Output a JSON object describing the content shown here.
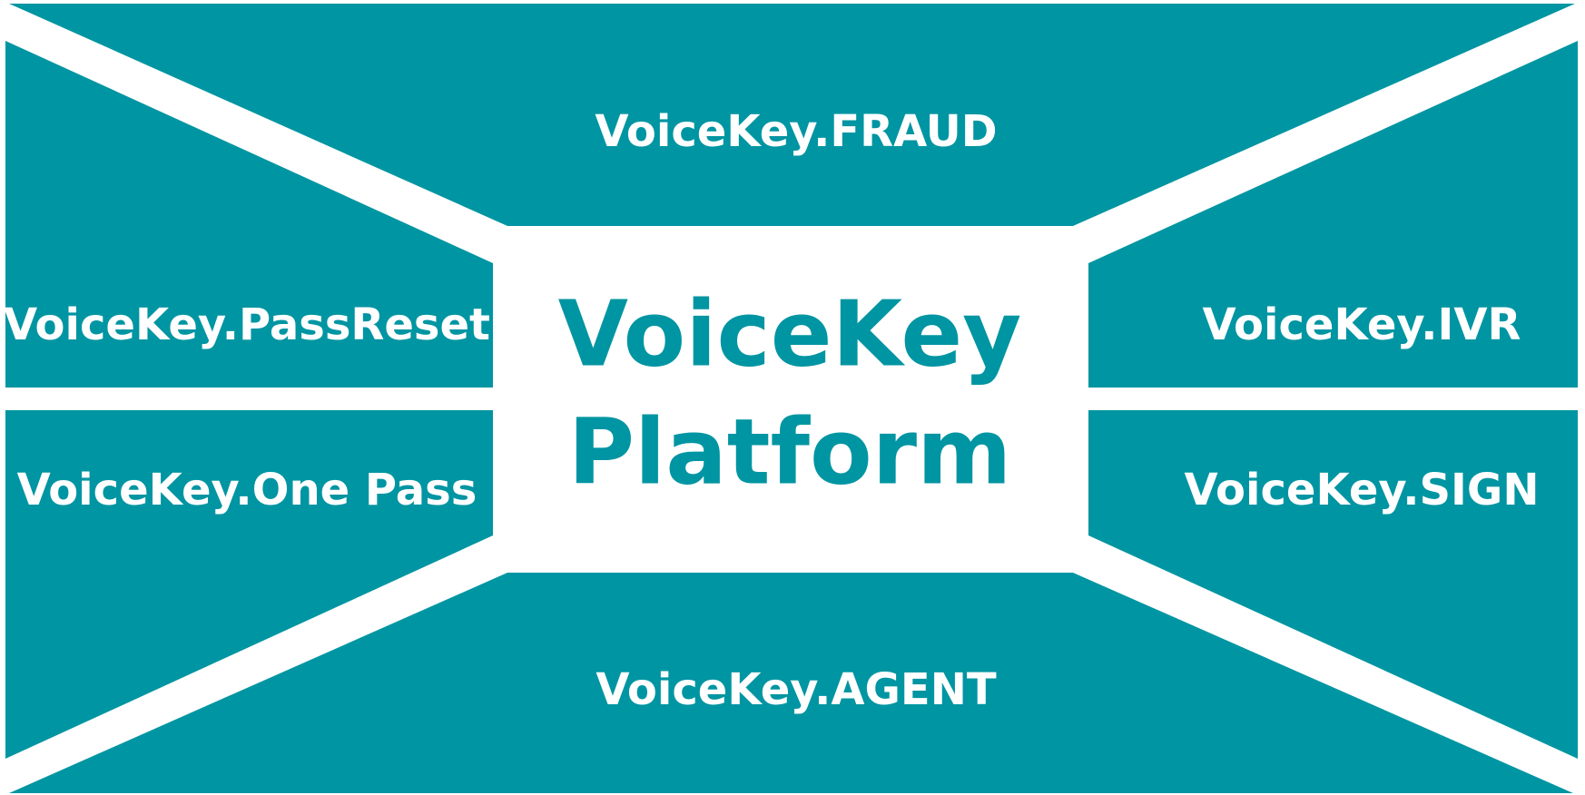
{
  "colors": {
    "segment": "#0095a2",
    "background": "#ffffff",
    "segment_text": "#ffffff",
    "center_text": "#0095a2"
  },
  "center": {
    "line1": "VoiceKey",
    "line2": "Platform"
  },
  "segments": {
    "top": "VoiceKey.FRAUD",
    "left_upper": "VoiceKey.PassReset",
    "left_lower": "VoiceKey.One Pass",
    "right_upper": "VoiceKey.IVR",
    "right_lower": "VoiceKey.SIGN",
    "bottom": "VoiceKey.AGENT"
  }
}
